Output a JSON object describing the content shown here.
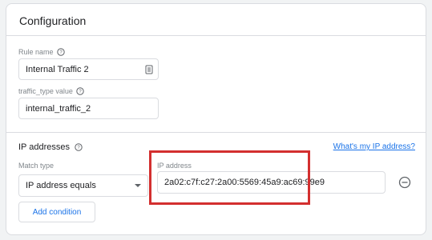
{
  "card": {
    "title": "Configuration"
  },
  "rule_name": {
    "label": "Rule name",
    "value": "Internal Traffic 2"
  },
  "traffic_type": {
    "label": "traffic_type value",
    "value": "internal_traffic_2"
  },
  "ip_addresses": {
    "title": "IP addresses",
    "help_link": "What's my IP address?",
    "match_type_label": "Match type",
    "match_type_value": "IP address equals",
    "ip_label": "IP address",
    "ip_value": "2a02:c7f:c27:2a00:5569:45a9:ac69:99e9",
    "add_condition_label": "Add condition"
  },
  "colors": {
    "accent": "#1a73e8",
    "highlight": "#d32f2f",
    "border": "#dadce0"
  }
}
